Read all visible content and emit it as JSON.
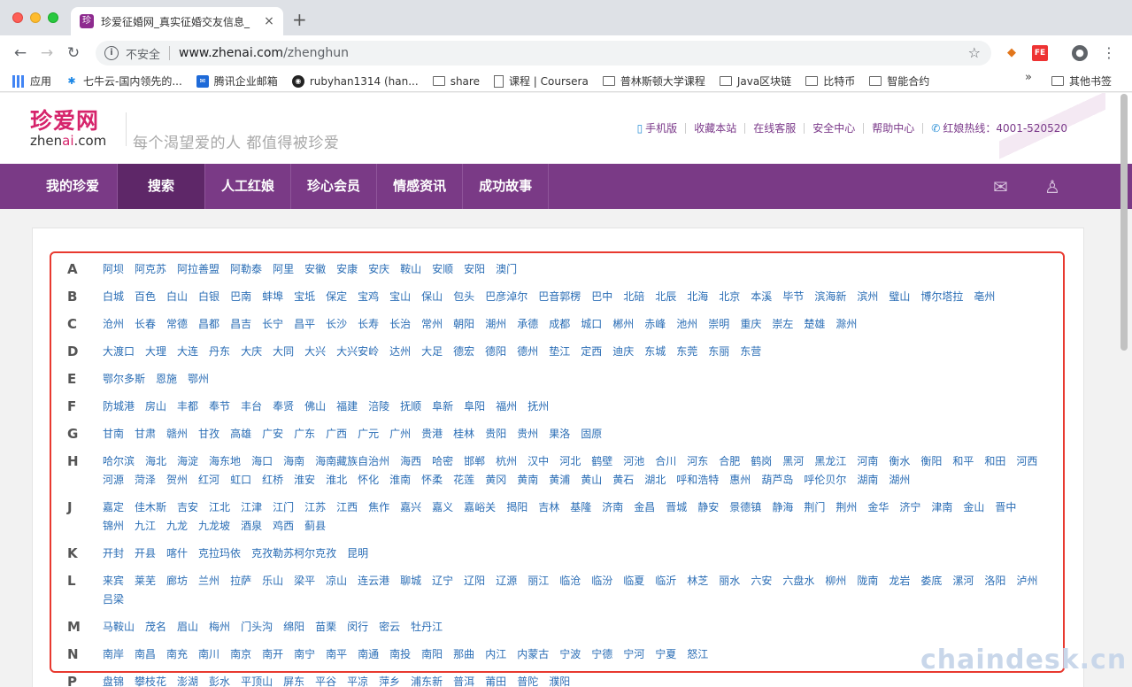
{
  "browser": {
    "tab_title": "珍爱征婚网_真实征婚交友信息_",
    "tab_favicon": "珍",
    "tab_close": "×",
    "new_tab": "+",
    "url_security": "不安全",
    "url_host": "www.zhenai.com",
    "url_path": "/zhenghun",
    "bookmarks": [
      {
        "label": "应用",
        "icon": "apps-icon"
      },
      {
        "label": "七牛云-国内领先的...",
        "icon": "qiniu-icon"
      },
      {
        "label": "腾讯企业邮箱",
        "icon": "tencent-mail-icon"
      },
      {
        "label": "rubyhan1314 (han...",
        "icon": "github-icon"
      },
      {
        "label": "share",
        "icon": "folder-icon"
      },
      {
        "label": "课程 | Coursera",
        "icon": "page-icon"
      },
      {
        "label": "普林斯顿大学课程",
        "icon": "folder-icon"
      },
      {
        "label": "Java区块链",
        "icon": "folder-icon"
      },
      {
        "label": "比特币",
        "icon": "folder-icon"
      },
      {
        "label": "智能合约",
        "icon": "folder-icon"
      }
    ],
    "bookmarks_more": "»",
    "other_bookmarks": "其他书签"
  },
  "site": {
    "logo_cn": "珍爱网",
    "logo_en_pre": "zhen",
    "logo_en_ai": "ai",
    "logo_en_post": ".com",
    "slogan": "每个渴望爱的人  都值得被珍爱",
    "top_links": [
      "手机版",
      "收藏本站",
      "在线客服",
      "安全中心",
      "帮助中心",
      "红娘热线：4001-520520"
    ],
    "nav": [
      "我的珍爱",
      "搜索",
      "人工红娘",
      "珍心会员",
      "情感资讯",
      "成功故事"
    ],
    "nav_active_index": 1,
    "accent_color": "#7a3a86"
  },
  "city_groups": [
    {
      "letter": "A",
      "cities": [
        "阿坝",
        "阿克苏",
        "阿拉善盟",
        "阿勒泰",
        "阿里",
        "安徽",
        "安康",
        "安庆",
        "鞍山",
        "安顺",
        "安阳",
        "澳门"
      ]
    },
    {
      "letter": "B",
      "cities": [
        "白城",
        "百色",
        "白山",
        "白银",
        "巴南",
        "蚌埠",
        "宝坻",
        "保定",
        "宝鸡",
        "宝山",
        "保山",
        "包头",
        "巴彦淖尔",
        "巴音郭楞",
        "巴中",
        "北碚",
        "北辰",
        "北海",
        "北京",
        "本溪",
        "毕节",
        "滨海新",
        "滨州",
        "璧山",
        "博尔塔拉",
        "亳州"
      ]
    },
    {
      "letter": "C",
      "cities": [
        "沧州",
        "长春",
        "常德",
        "昌都",
        "昌吉",
        "长宁",
        "昌平",
        "长沙",
        "长寿",
        "长治",
        "常州",
        "朝阳",
        "潮州",
        "承德",
        "成都",
        "城口",
        "郴州",
        "赤峰",
        "池州",
        "崇明",
        "重庆",
        "崇左",
        "楚雄",
        "滁州"
      ]
    },
    {
      "letter": "D",
      "cities": [
        "大渡口",
        "大理",
        "大连",
        "丹东",
        "大庆",
        "大同",
        "大兴",
        "大兴安岭",
        "达州",
        "大足",
        "德宏",
        "德阳",
        "德州",
        "垫江",
        "定西",
        "迪庆",
        "东城",
        "东莞",
        "东丽",
        "东营"
      ]
    },
    {
      "letter": "E",
      "cities": [
        "鄂尔多斯",
        "恩施",
        "鄂州"
      ]
    },
    {
      "letter": "F",
      "cities": [
        "防城港",
        "房山",
        "丰都",
        "奉节",
        "丰台",
        "奉贤",
        "佛山",
        "福建",
        "涪陵",
        "抚顺",
        "阜新",
        "阜阳",
        "福州",
        "抚州"
      ]
    },
    {
      "letter": "G",
      "cities": [
        "甘南",
        "甘肃",
        "赣州",
        "甘孜",
        "高雄",
        "广安",
        "广东",
        "广西",
        "广元",
        "广州",
        "贵港",
        "桂林",
        "贵阳",
        "贵州",
        "果洛",
        "固原"
      ]
    },
    {
      "letter": "H",
      "cities": [
        "哈尔滨",
        "海北",
        "海淀",
        "海东地",
        "海口",
        "海南",
        "海南藏族自治州",
        "海西",
        "哈密",
        "邯郸",
        "杭州",
        "汉中",
        "河北",
        "鹤壁",
        "河池",
        "合川",
        "河东",
        "合肥",
        "鹤岗",
        "黑河",
        "黑龙江",
        "河南",
        "衡水",
        "衡阳",
        "和平",
        "和田",
        "河西",
        "河源",
        "菏泽",
        "贺州",
        "红河",
        "虹口",
        "红桥",
        "淮安",
        "淮北",
        "怀化",
        "淮南",
        "怀柔",
        "花莲",
        "黄冈",
        "黄南",
        "黄浦",
        "黄山",
        "黄石",
        "湖北",
        "呼和浩特",
        "惠州",
        "葫芦岛",
        "呼伦贝尔",
        "湖南",
        "湖州"
      ]
    },
    {
      "letter": "J",
      "cities": [
        "嘉定",
        "佳木斯",
        "吉安",
        "江北",
        "江津",
        "江门",
        "江苏",
        "江西",
        "焦作",
        "嘉兴",
        "嘉义",
        "嘉峪关",
        "揭阳",
        "吉林",
        "基隆",
        "济南",
        "金昌",
        "晋城",
        "静安",
        "景德镇",
        "静海",
        "荆门",
        "荆州",
        "金华",
        "济宁",
        "津南",
        "金山",
        "晋中",
        "锦州",
        "九江",
        "九龙",
        "九龙坡",
        "酒泉",
        "鸡西",
        "蓟县"
      ]
    },
    {
      "letter": "K",
      "cities": [
        "开封",
        "开县",
        "喀什",
        "克拉玛依",
        "克孜勒苏柯尔克孜",
        "昆明"
      ]
    },
    {
      "letter": "L",
      "cities": [
        "来宾",
        "莱芜",
        "廊坊",
        "兰州",
        "拉萨",
        "乐山",
        "梁平",
        "凉山",
        "连云港",
        "聊城",
        "辽宁",
        "辽阳",
        "辽源",
        "丽江",
        "临沧",
        "临汾",
        "临夏",
        "临沂",
        "林芝",
        "丽水",
        "六安",
        "六盘水",
        "柳州",
        "陇南",
        "龙岩",
        "娄底",
        "漯河",
        "洛阳",
        "泸州",
        "吕梁"
      ]
    },
    {
      "letter": "M",
      "cities": [
        "马鞍山",
        "茂名",
        "眉山",
        "梅州",
        "门头沟",
        "绵阳",
        "苗栗",
        "闵行",
        "密云",
        "牡丹江"
      ]
    },
    {
      "letter": "N",
      "cities": [
        "南岸",
        "南昌",
        "南充",
        "南川",
        "南京",
        "南开",
        "南宁",
        "南平",
        "南通",
        "南投",
        "南阳",
        "那曲",
        "内江",
        "内蒙古",
        "宁波",
        "宁德",
        "宁河",
        "宁夏",
        "怒江"
      ]
    },
    {
      "letter": "P",
      "cities": [
        "盘锦",
        "攀枝花",
        "澎湖",
        "彭水",
        "平顶山",
        "屏东",
        "平谷",
        "平凉",
        "萍乡",
        "浦东新",
        "普洱",
        "莆田",
        "普陀",
        "濮阳"
      ]
    }
  ],
  "watermark": "chaindesk.cn"
}
